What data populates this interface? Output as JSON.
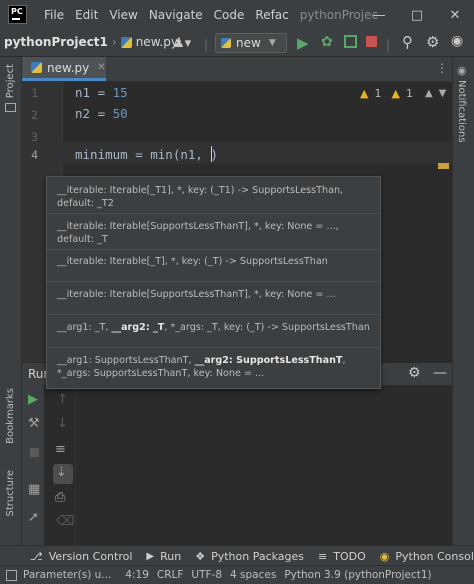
{
  "titlebar": {
    "logo_text": "PC",
    "menu": [
      "File",
      "Edit",
      "View",
      "Navigate",
      "Code",
      "Refac"
    ],
    "project_title": "pythonProjec"
  },
  "navbar": {
    "project": "pythonProject1",
    "file": "new.py",
    "run_config": "new"
  },
  "editor": {
    "tab_label": "new.py",
    "lines": [
      {
        "number": "1",
        "var": "n1",
        "op": " = ",
        "value": "15"
      },
      {
        "number": "2",
        "var": "n2",
        "op": " = ",
        "value": "50"
      },
      {
        "number": "3"
      },
      {
        "number": "4",
        "code": "minimum = min(n1, )"
      }
    ],
    "inspections": {
      "warn1": "1",
      "warn2": "1"
    }
  },
  "popup": {
    "signatures": [
      {
        "text": "__iterable: Iterable[_T1], *, key: (_T1) -> SupportsLessThan, default: _T2"
      },
      {
        "text": "__iterable: Iterable[SupportsLessThanT], *, key: None = ..., default: _T"
      },
      {
        "text": "__iterable: Iterable[_T], *, key: (_T) -> SupportsLessThan"
      },
      {
        "text": "__iterable: Iterable[SupportsLessThanT], *, key: None = ..."
      },
      {
        "pre": "__arg1: _T, ",
        "bold": "__arg2: _T",
        "post": ", *_args: _T, key: (_T) -> SupportsLessThan"
      },
      {
        "pre": "__arg1: SupportsLessThanT, ",
        "bold": "__arg2: SupportsLessThanT",
        "post": ", *_args: SupportsLessThanT, key: None = ..."
      }
    ]
  },
  "side": {
    "project": "Project",
    "bookmarks": "Bookmarks",
    "structure": "Structure",
    "notifications": "Notifications",
    "run_header": "Run"
  },
  "bottom_tabs": [
    "Version Control",
    "Run",
    "Python Packages",
    "TODO",
    "Python Consol"
  ],
  "status": {
    "message": "Parameter(s) u...",
    "position": "4:19",
    "line_sep": "CRLF",
    "encoding": "UTF-8",
    "indent": "4 spaces",
    "interpreter": "Python 3.9 (pythonProject1)"
  },
  "colors": {
    "accent": "#4a88c7",
    "run_green": "#59a869",
    "warning": "#e6b422"
  }
}
